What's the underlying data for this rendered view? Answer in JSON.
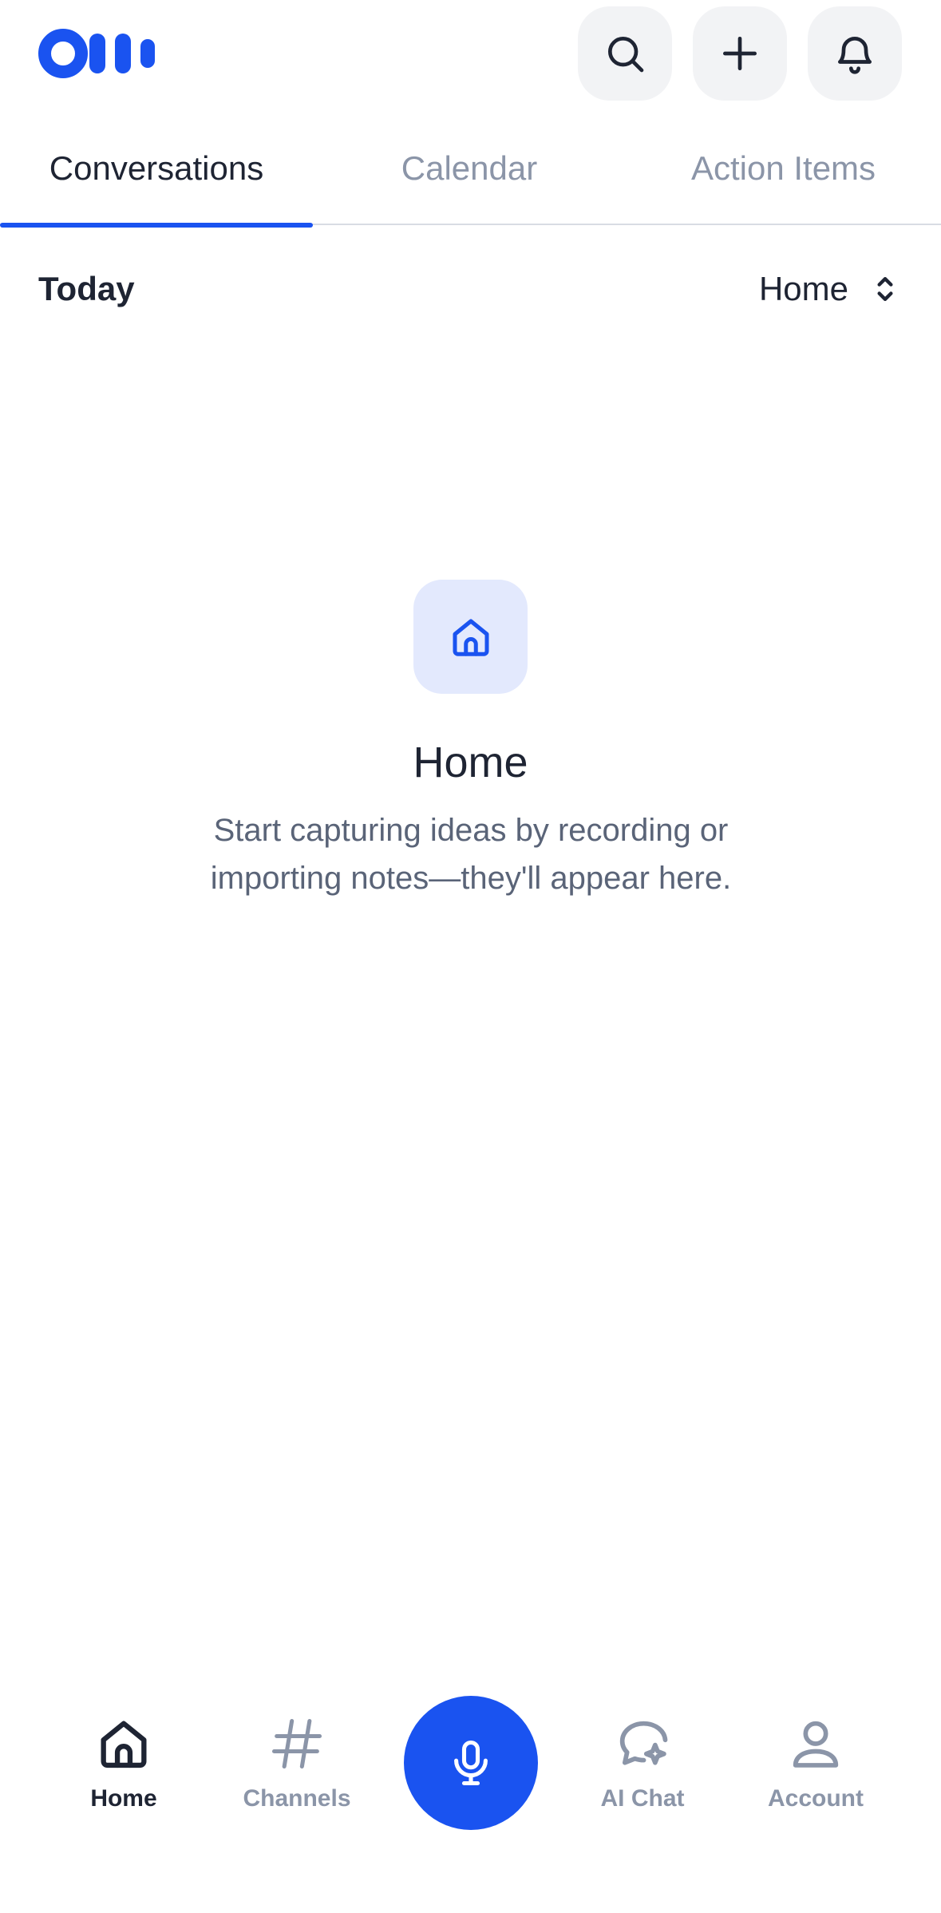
{
  "brand": {
    "accent_color": "#1a53f0",
    "logo_icon": "otter-logo-icon"
  },
  "header": {
    "search_icon": "search-icon",
    "add_icon": "plus-icon",
    "notifications_icon": "bell-icon"
  },
  "tabs": [
    {
      "label": "Conversations",
      "active": true
    },
    {
      "label": "Calendar",
      "active": false
    },
    {
      "label": "Action Items",
      "active": false
    }
  ],
  "filter": {
    "section_label": "Today",
    "selected_folder": "Home",
    "selector_icon": "chevron-up-down-icon"
  },
  "empty_state": {
    "icon": "home-icon",
    "title": "Home",
    "description": "Start capturing ideas by recording or importing notes—they'll appear here."
  },
  "bottom_nav": {
    "items": [
      {
        "label": "Home",
        "icon": "home-icon",
        "active": true
      },
      {
        "label": "Channels",
        "icon": "hashtag-icon",
        "active": false
      },
      {
        "label": "AI Chat",
        "icon": "ai-chat-icon",
        "active": false
      },
      {
        "label": "Account",
        "icon": "user-icon",
        "active": false
      }
    ],
    "record_icon": "microphone-icon"
  }
}
